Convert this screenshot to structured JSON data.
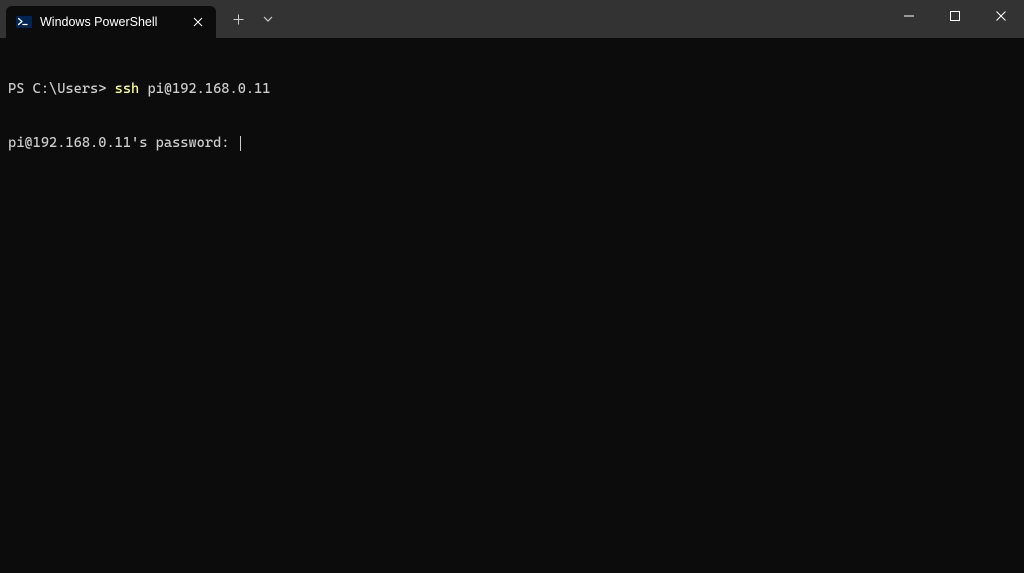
{
  "titlebar": {
    "tab": {
      "title": "Windows PowerShell"
    }
  },
  "terminal": {
    "prompt_prefix": "PS C:\\Users> ",
    "command_keyword": "ssh",
    "command_arg": " pi@192.168.0.11",
    "password_prompt": "pi@192.168.0.11's password: "
  }
}
